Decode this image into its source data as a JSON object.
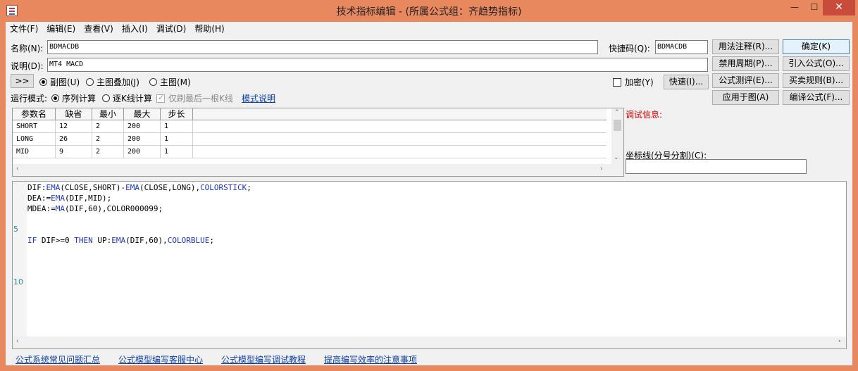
{
  "window": {
    "title": "技术指标编辑 - (所属公式组：齐趋势指标)",
    "minimize_icon": "minimize-icon",
    "maximize_icon": "maximize-icon",
    "close_icon": "close-icon",
    "minimize_glyph": "—",
    "maximize_glyph": "☐",
    "close_glyph": "✕"
  },
  "menu": [
    "文件(F)",
    "编辑(E)",
    "查看(V)",
    "插入(I)",
    "调试(D)",
    "帮助(H)"
  ],
  "form": {
    "name_label": "名称(N):",
    "name_value": "BDMACDB",
    "shortcut_label": "快捷码(Q):",
    "shortcut_value": "BDMACDB",
    "desc_label": "说明(D):",
    "desc_value": "MT4 MACD",
    "expand_button": ">>",
    "radio_sub": "副图(U)",
    "radio_main_overlay": "主图叠加(J)",
    "radio_main": "主图(M)",
    "encrypt_label": "加密(Y)",
    "quick_button": "快速(I)...",
    "run_mode_label": "运行模式:",
    "run_seq": "序列计算",
    "run_bar": "逐K线计算",
    "refresh_last": "仅刷最后一根K线",
    "mode_help_link": "模式说明"
  },
  "right_buttons": {
    "usage_note": "用法注释(R)...",
    "ok": "确定(K)",
    "disabled_period": "禁用周期(P)...",
    "import_formula": "引入公式(O)...",
    "formula_test": "公式测评(E)...",
    "trade_rules": "买卖规则(B)...",
    "apply_to_chart": "应用于图(A)",
    "compile": "编译公式(F)..."
  },
  "debug": {
    "label": "调试信息:",
    "axis_label": "坐标线(分号分割)(C):",
    "axis_value": ""
  },
  "param_table": {
    "headers": [
      "参数名",
      "缺省",
      "最小",
      "最大",
      "步长"
    ],
    "rows": [
      [
        "SHORT",
        "12",
        "2",
        "200",
        "1"
      ],
      [
        "LONG",
        "26",
        "2",
        "200",
        "1"
      ],
      [
        "MID",
        "9",
        "2",
        "200",
        "1"
      ]
    ]
  },
  "editor": {
    "line_numbers": [
      "5",
      "10"
    ],
    "code": [
      {
        "parts": [
          [
            "t",
            "DIF:"
          ],
          [
            "f",
            "EMA"
          ],
          [
            "t",
            "(CLOSE,SHORT)-"
          ],
          [
            "f",
            "EMA"
          ],
          [
            "t",
            "(CLOSE,LONG),"
          ],
          [
            "c",
            "COLORSTICK"
          ],
          [
            "t",
            ";"
          ]
        ]
      },
      {
        "parts": [
          [
            "t",
            "DEA:="
          ],
          [
            "f",
            "EMA"
          ],
          [
            "t",
            "(DIF,MID);"
          ]
        ]
      },
      {
        "parts": [
          [
            "t",
            "MDEA:="
          ],
          [
            "f",
            "MA"
          ],
          [
            "t",
            "(DIF,60),COLOR000099;"
          ]
        ]
      },
      {
        "parts": []
      },
      {
        "parts": []
      },
      {
        "parts": [
          [
            "k",
            "IF"
          ],
          [
            "t",
            " DIF>=0 "
          ],
          [
            "k",
            "THEN"
          ],
          [
            "t",
            " UP:"
          ],
          [
            "f",
            "EMA"
          ],
          [
            "t",
            "(DIF,60),"
          ],
          [
            "c",
            "COLORBLUE"
          ],
          [
            "t",
            ";"
          ]
        ]
      }
    ]
  },
  "footer_links": [
    "公式系统常见问题汇总",
    "公式模型编写客服中心",
    "公式模型编写调试教程",
    "提高编写效率的注意事项"
  ]
}
